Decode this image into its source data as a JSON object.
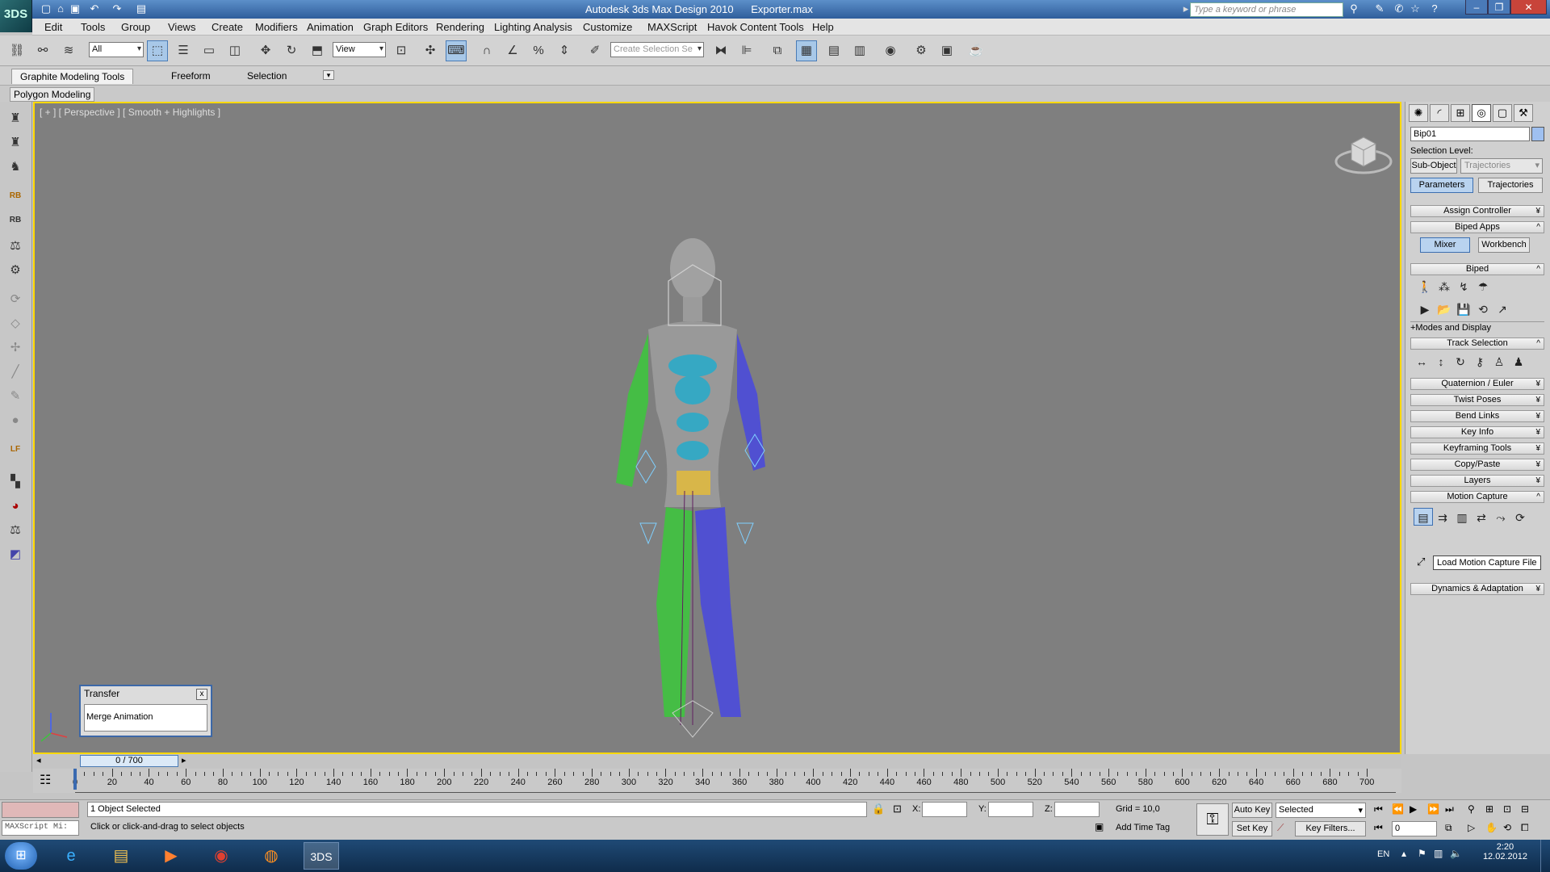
{
  "titlebar": {
    "app_title": "Autodesk 3ds Max Design 2010",
    "file_title": "Exporter.max",
    "logo": "3DS",
    "search_placeholder": "Type a keyword or phrase"
  },
  "menus": [
    "Edit",
    "Tools",
    "Group",
    "Views",
    "Create",
    "Modifiers",
    "Animation",
    "Graph Editors",
    "Rendering",
    "Lighting Analysis",
    "Customize",
    "MAXScript",
    "Havok Content Tools",
    "Help"
  ],
  "toolbar": {
    "filter_value": "All",
    "refcoord_value": "View",
    "selection_set_placeholder": "Create Selection Se"
  },
  "ribbon": {
    "tabs": [
      "Graphite Modeling Tools",
      "Freeform",
      "Selection"
    ],
    "panel_label": "Polygon Modeling"
  },
  "viewport": {
    "label": "[ + ] [ Perspective ] [ Smooth + Highlights ]"
  },
  "transfer_dialog": {
    "title": "Transfer",
    "close": "x",
    "field": "Merge Animation"
  },
  "command_panel": {
    "object_name": "Bip01",
    "selection_level_label": "Selection Level:",
    "sub_object_btn": "Sub-Object",
    "sub_object_dropdown": "Trajectories",
    "parameters_btn": "Parameters",
    "trajectories_btn": "Trajectories",
    "rollouts": {
      "assign_controller": "Assign Controller",
      "biped_apps": "Biped Apps",
      "biped": "Biped",
      "modes_display": "+Modes and Display",
      "track_selection": "Track Selection",
      "quaternion": "Quaternion / Euler",
      "twist_poses": "Twist Poses",
      "bend_links": "Bend Links",
      "key_info": "Key Info",
      "keyframing_tools": "Keyframing Tools",
      "copy_paste": "Copy/Paste",
      "layers": "Layers",
      "motion_capture": "Motion Capture",
      "dynamics": "Dynamics & Adaptation"
    },
    "mixer_btn": "Mixer",
    "workbench_btn": "Workbench",
    "tooltip": "Load Motion Capture File"
  },
  "timeline": {
    "slider_label": "0 / 700",
    "ticks": [
      "0",
      "20",
      "40",
      "60",
      "80",
      "100",
      "120",
      "140",
      "160",
      "180",
      "200",
      "220",
      "240",
      "260",
      "280",
      "300",
      "320",
      "340",
      "360",
      "380",
      "400",
      "420",
      "440",
      "460",
      "480",
      "500",
      "520",
      "540",
      "560",
      "580",
      "600",
      "620",
      "640",
      "660",
      "680",
      "700"
    ]
  },
  "status": {
    "maxscript": "MAXScript Mi:",
    "selected": "1 Object Selected",
    "prompt": "Click or click-and-drag to select objects",
    "x_label": "X:",
    "y_label": "Y:",
    "z_label": "Z:",
    "grid": "Grid = 10,0",
    "add_time_tag": "Add Time Tag",
    "auto_key": "Auto Key",
    "set_key": "Set Key",
    "selected_dropdown": "Selected",
    "key_filters": "Key Filters...",
    "frame_value": "0"
  },
  "taskbar": {
    "lang": "EN",
    "time": "2:20",
    "date": "12.02.2012"
  }
}
